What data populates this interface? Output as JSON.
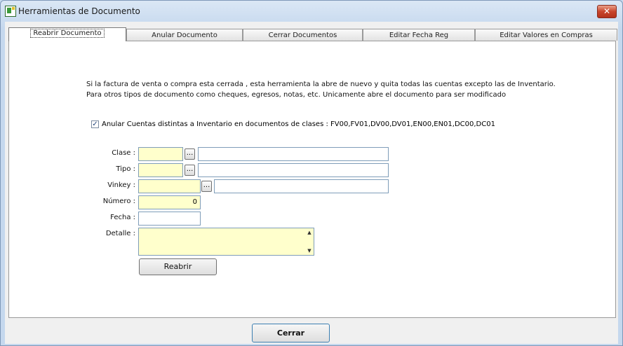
{
  "window": {
    "title": "Herramientas de Documento",
    "close_glyph": "✕"
  },
  "tabs": [
    {
      "label": "Reabrir Documento"
    },
    {
      "label": "Anular Documento"
    },
    {
      "label": "Cerrar Documentos"
    },
    {
      "label": "Editar Fecha Reg"
    },
    {
      "label": "Editar Valores en Compras"
    }
  ],
  "info": {
    "line1": "Si la factura de venta o compra esta cerrada , esta herramienta la abre de  nuevo y quita todas las cuentas excepto las de Inventario.",
    "line2": "Para otros tipos de documento como cheques, egresos, notas, etc. Unicamente abre el documento para ser modificado"
  },
  "checkbox": {
    "label": "Anular Cuentas distintas a Inventario en documentos de clases : FV00,FV01,DV00,DV01,EN00,EN01,DC00,DC01",
    "checked_glyph": "✓"
  },
  "form": {
    "clase_label": "Clase :",
    "tipo_label": "Tipo :",
    "vinkey_label": "Vinkey :",
    "numero_label": "Número :",
    "numero_value": "0",
    "fecha_label": "Fecha :",
    "detalle_label": "Detalle :",
    "lookup_glyph": "...",
    "scroll_up": "▲",
    "scroll_down": "▼"
  },
  "buttons": {
    "reabrir": "Reabrir",
    "cerrar": "Cerrar"
  }
}
